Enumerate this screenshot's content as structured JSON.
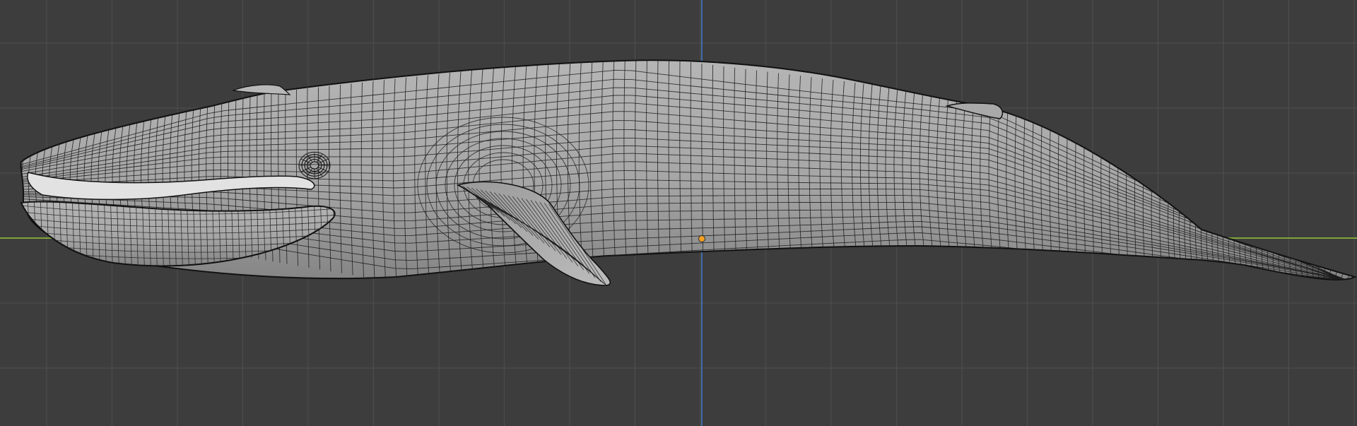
{
  "viewport": {
    "view": "side-orthographic",
    "shading": "solid-wireframe",
    "object": "whale-mesh",
    "grid": true,
    "colors": {
      "background": "#3d3d3d",
      "grid_line": "#4c4c4c",
      "x_axis": "#7fa53a",
      "z_axis": "#3f7bc8",
      "mesh_fill": "#a8a8a8",
      "mesh_shadow": "#7c7c7c",
      "wire": "#1c1c1c",
      "origin": "#f5a023"
    }
  }
}
